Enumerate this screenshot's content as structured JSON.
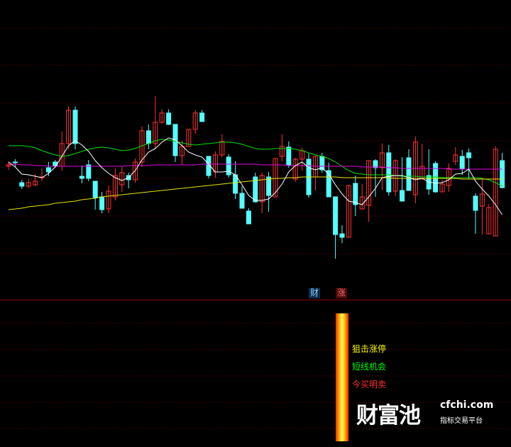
{
  "chart_data": {
    "type": "candlestick",
    "title": "",
    "ohlc": [
      [
        226,
        228,
        233,
        221
      ],
      [
        232,
        231,
        236,
        225
      ],
      [
        203,
        198,
        207,
        194
      ],
      [
        198,
        203,
        208,
        195
      ],
      [
        200,
        205,
        215,
        198
      ],
      [
        210,
        211,
        223,
        205
      ],
      [
        224,
        218,
        232,
        212
      ],
      [
        232,
        226,
        235,
        224
      ],
      [
        226,
        258,
        275,
        220
      ],
      [
        258,
        305,
        310,
        250
      ],
      [
        305,
        258,
        310,
        250
      ],
      [
        212,
        209,
        227,
        202
      ],
      [
        228,
        209,
        235,
        205
      ],
      [
        205,
        182,
        200,
        165
      ],
      [
        183,
        165,
        190,
        160
      ],
      [
        166,
        191,
        199,
        160
      ],
      [
        183,
        213,
        223,
        178
      ],
      [
        200,
        217,
        225,
        190
      ],
      [
        213,
        207,
        217,
        195
      ],
      [
        207,
        232,
        237,
        203
      ],
      [
        232,
        276,
        282,
        225
      ],
      [
        276,
        258,
        285,
        250
      ],
      [
        258,
        288,
        325,
        250
      ],
      [
        288,
        301,
        306,
        286
      ],
      [
        301,
        285,
        306,
        284
      ],
      [
        285,
        241,
        285,
        232
      ],
      [
        241,
        254,
        262,
        228
      ],
      [
        254,
        278,
        265,
        270
      ],
      [
        278,
        301,
        305,
        272
      ],
      [
        301,
        289,
        305,
        289
      ],
      [
        240,
        213,
        234,
        209
      ],
      [
        218,
        242,
        247,
        210
      ],
      [
        242,
        261,
        271,
        239
      ],
      [
        239,
        214,
        243,
        210
      ],
      [
        214,
        188,
        233,
        180
      ],
      [
        188,
        167,
        198,
        167
      ],
      [
        163,
        145,
        167,
        145
      ],
      [
        211,
        176,
        217,
        175
      ],
      [
        176,
        213,
        217,
        160
      ],
      [
        211,
        185,
        218,
        162
      ],
      [
        183,
        237,
        220,
        185
      ],
      [
        240,
        254,
        271,
        233
      ],
      [
        253,
        228,
        261,
        224
      ],
      [
        208,
        236,
        238,
        204
      ],
      [
        236,
        248,
        252,
        220
      ],
      [
        236,
        186,
        244,
        182
      ],
      [
        211,
        240,
        240,
        192
      ],
      [
        240,
        221,
        245,
        217
      ],
      [
        220,
        183,
        231,
        196
      ],
      [
        183,
        130,
        94,
        96
      ],
      [
        131,
        126,
        143,
        118
      ],
      [
        126,
        199,
        200,
        155
      ],
      [
        202,
        172,
        213,
        156
      ],
      [
        166,
        183,
        201,
        168
      ],
      [
        171,
        234,
        229,
        148
      ],
      [
        234,
        224,
        236,
        183
      ],
      [
        224,
        245,
        258,
        192
      ],
      [
        245,
        190,
        256,
        185
      ],
      [
        191,
        234,
        236,
        184
      ],
      [
        192,
        177,
        239,
        178
      ],
      [
        238,
        192,
        250,
        192
      ],
      [
        186,
        260,
        268,
        174
      ],
      [
        208,
        226,
        258,
        225
      ],
      [
        213,
        194,
        250,
        186
      ],
      [
        230,
        190,
        233,
        189
      ],
      [
        190,
        201,
        207,
        193
      ],
      [
        199,
        223,
        230,
        190
      ],
      [
        233,
        242,
        253,
        228
      ],
      [
        240,
        223,
        249,
        214
      ],
      [
        245,
        238,
        251,
        208
      ],
      [
        184,
        164,
        188,
        131
      ],
      [
        170,
        187,
        208,
        130
      ],
      [
        131,
        168,
        173,
        165
      ],
      [
        128,
        250,
        254,
        224
      ],
      [
        234,
        196,
        245,
        195
      ]
    ],
    "series": [
      {
        "values": [
          255,
          255,
          255,
          254,
          252,
          248,
          245,
          242,
          240,
          241,
          244,
          247,
          250,
          252,
          253,
          252,
          250,
          248,
          249,
          251,
          255,
          258,
          262,
          264,
          263,
          261,
          259,
          257,
          256,
          257,
          258,
          259,
          260,
          260,
          259,
          257,
          254,
          251,
          250,
          250,
          251,
          251,
          251,
          250,
          248,
          245,
          242,
          240,
          237,
          232,
          226,
          220,
          216,
          215,
          214,
          214,
          214,
          214,
          213,
          212,
          212,
          212,
          211,
          211,
          211,
          210,
          210,
          210,
          210,
          210,
          210,
          209,
          207,
          203,
          198
        ]
      },
      {
        "values": [
          229,
          229,
          228,
          228,
          227,
          227,
          226,
          226,
          226,
          226,
          226,
          226,
          226,
          226,
          226,
          226,
          226,
          226,
          227,
          227,
          227,
          227,
          228,
          228,
          228,
          228,
          228,
          228,
          228,
          229,
          229,
          229,
          229,
          229,
          229,
          229,
          229,
          229,
          228,
          228,
          228,
          228,
          227,
          227,
          227,
          227,
          226,
          226,
          226,
          226,
          226,
          226,
          226,
          225,
          225,
          225,
          225,
          224,
          224,
          223,
          223,
          223,
          223,
          223,
          223,
          223,
          222,
          222,
          222,
          222,
          222,
          222,
          222,
          222,
          222
        ]
      },
      {
        "values": [
          165,
          166,
          167,
          169,
          170,
          171,
          172,
          174,
          175,
          176,
          177,
          179,
          180,
          181,
          183,
          184,
          185,
          186,
          187,
          188,
          189,
          190,
          191,
          192,
          193,
          194,
          195,
          196,
          197,
          198,
          199,
          200,
          201,
          202,
          203,
          204,
          205,
          206,
          207,
          208,
          209,
          209,
          210,
          210,
          211,
          211,
          211,
          211,
          211,
          211,
          210,
          210,
          210,
          210,
          210,
          210,
          210,
          210,
          209,
          209,
          209,
          209,
          209,
          209,
          209,
          209,
          209,
          209,
          208,
          208,
          208,
          208,
          208,
          208,
          208
        ]
      },
      {
        "values": [
          232,
          225,
          215,
          214,
          212,
          210,
          216,
          225,
          240,
          255,
          262,
          256,
          247,
          234,
          224,
          216,
          210,
          206,
          210,
          220,
          235,
          246,
          251,
          260,
          266,
          263,
          255,
          246,
          242,
          239,
          229,
          218,
          218,
          219,
          214,
          200,
          185,
          178,
          178,
          180,
          189,
          201,
          218,
          227,
          232,
          224,
          221,
          224,
          215,
          200,
          187,
          177,
          175,
          172,
          183,
          195,
          210,
          212,
          213,
          213,
          210,
          207,
          209,
          204,
          202,
          203,
          207,
          215,
          216,
          222,
          205,
          194,
          184,
          172,
          158
        ]
      }
    ],
    "labels": {
      "cai": "财",
      "zhang": "涨"
    },
    "legend": [
      "狙击涨停",
      "短线机会",
      "今买明卖"
    ],
    "watermark": {
      "brand": "财富池",
      "url": "cfchi.com",
      "tagline": "指标交易平台"
    },
    "colors": {
      "up": "#ff3232",
      "down": "#54ffff",
      "ma1": "#ffffff",
      "ma2": "#e000e0",
      "ma3": "#00e000",
      "ma4": "#e6e600",
      "grid": "#7a0000",
      "divider": "#a00000",
      "legend0": "#ffff00",
      "legend1": "#00ff00",
      "legend2": "#ff3030"
    }
  }
}
